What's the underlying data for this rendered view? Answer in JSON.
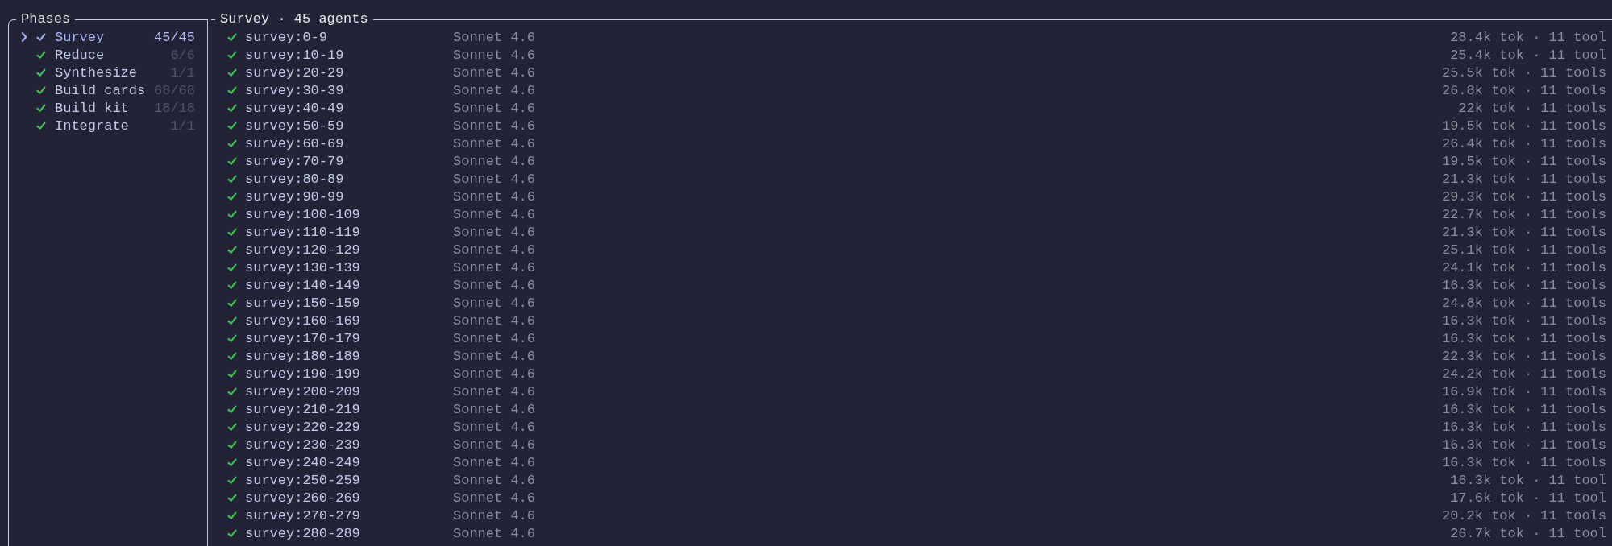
{
  "phases_panel": {
    "title": "Phases",
    "items": [
      {
        "name": "Survey",
        "count": "45/45",
        "done": true,
        "selected": true
      },
      {
        "name": "Reduce",
        "count": "6/6",
        "done": true,
        "selected": false
      },
      {
        "name": "Synthesize",
        "count": "1/1",
        "done": true,
        "selected": false
      },
      {
        "name": "Build cards",
        "count": "68/68",
        "done": true,
        "selected": false
      },
      {
        "name": "Build kit",
        "count": "18/18",
        "done": true,
        "selected": false
      },
      {
        "name": "Integrate",
        "count": "1/1",
        "done": true,
        "selected": false
      }
    ]
  },
  "agents_panel": {
    "title": "Survey · 45 agents",
    "rows": [
      {
        "name": "survey:0-9",
        "model": "Sonnet 4.6",
        "stats": "28.4k tok · 11 tool",
        "done": true
      },
      {
        "name": "survey:10-19",
        "model": "Sonnet 4.6",
        "stats": "25.4k tok · 11 tool",
        "done": true
      },
      {
        "name": "survey:20-29",
        "model": "Sonnet 4.6",
        "stats": "25.5k tok · 11 tools",
        "done": true
      },
      {
        "name": "survey:30-39",
        "model": "Sonnet 4.6",
        "stats": "26.8k tok · 11 tools",
        "done": true
      },
      {
        "name": "survey:40-49",
        "model": "Sonnet 4.6",
        "stats": "22k tok · 11 tools",
        "done": true
      },
      {
        "name": "survey:50-59",
        "model": "Sonnet 4.6",
        "stats": "19.5k tok · 11 tools",
        "done": true
      },
      {
        "name": "survey:60-69",
        "model": "Sonnet 4.6",
        "stats": "26.4k tok · 11 tools",
        "done": true
      },
      {
        "name": "survey:70-79",
        "model": "Sonnet 4.6",
        "stats": "19.5k tok · 11 tools",
        "done": true
      },
      {
        "name": "survey:80-89",
        "model": "Sonnet 4.6",
        "stats": "21.3k tok · 11 tools",
        "done": true
      },
      {
        "name": "survey:90-99",
        "model": "Sonnet 4.6",
        "stats": "29.3k tok · 11 tools",
        "done": true
      },
      {
        "name": "survey:100-109",
        "model": "Sonnet 4.6",
        "stats": "22.7k tok · 11 tools",
        "done": true
      },
      {
        "name": "survey:110-119",
        "model": "Sonnet 4.6",
        "stats": "21.3k tok · 11 tools",
        "done": true
      },
      {
        "name": "survey:120-129",
        "model": "Sonnet 4.6",
        "stats": "25.1k tok · 11 tools",
        "done": true
      },
      {
        "name": "survey:130-139",
        "model": "Sonnet 4.6",
        "stats": "24.1k tok · 11 tools",
        "done": true
      },
      {
        "name": "survey:140-149",
        "model": "Sonnet 4.6",
        "stats": "16.3k tok · 11 tools",
        "done": true
      },
      {
        "name": "survey:150-159",
        "model": "Sonnet 4.6",
        "stats": "24.8k tok · 11 tools",
        "done": true
      },
      {
        "name": "survey:160-169",
        "model": "Sonnet 4.6",
        "stats": "16.3k tok · 11 tools",
        "done": true
      },
      {
        "name": "survey:170-179",
        "model": "Sonnet 4.6",
        "stats": "16.3k tok · 11 tools",
        "done": true
      },
      {
        "name": "survey:180-189",
        "model": "Sonnet 4.6",
        "stats": "22.3k tok · 11 tools",
        "done": true
      },
      {
        "name": "survey:190-199",
        "model": "Sonnet 4.6",
        "stats": "24.2k tok · 11 tools",
        "done": true
      },
      {
        "name": "survey:200-209",
        "model": "Sonnet 4.6",
        "stats": "16.9k tok · 11 tools",
        "done": true
      },
      {
        "name": "survey:210-219",
        "model": "Sonnet 4.6",
        "stats": "16.3k tok · 11 tools",
        "done": true
      },
      {
        "name": "survey:220-229",
        "model": "Sonnet 4.6",
        "stats": "16.3k tok · 11 tools",
        "done": true
      },
      {
        "name": "survey:230-239",
        "model": "Sonnet 4.6",
        "stats": "16.3k tok · 11 tools",
        "done": true
      },
      {
        "name": "survey:240-249",
        "model": "Sonnet 4.6",
        "stats": "16.3k tok · 11 tools",
        "done": true
      },
      {
        "name": "survey:250-259",
        "model": "Sonnet 4.6",
        "stats": "16.3k tok · 11 tool",
        "done": true
      },
      {
        "name": "survey:260-269",
        "model": "Sonnet 4.6",
        "stats": "17.6k tok · 11 tool",
        "done": true
      },
      {
        "name": "survey:270-279",
        "model": "Sonnet 4.6",
        "stats": "20.2k tok · 11 tools",
        "done": true
      },
      {
        "name": "survey:280-289",
        "model": "Sonnet 4.6",
        "stats": "26.7k tok · 11 tool",
        "done": true
      }
    ]
  }
}
